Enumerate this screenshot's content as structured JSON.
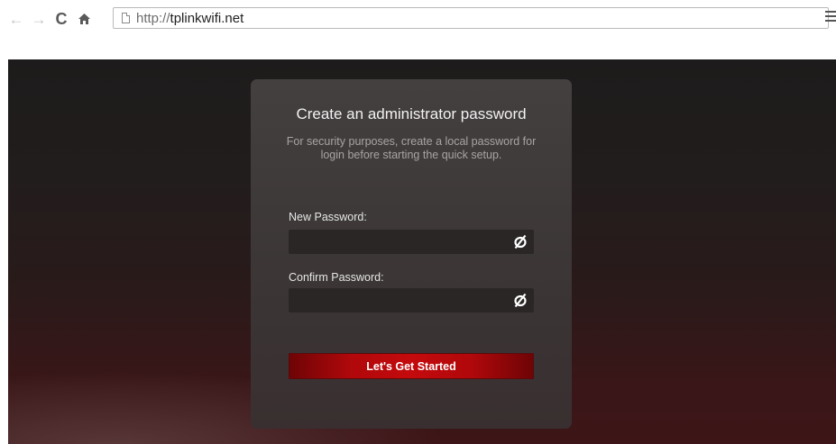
{
  "browser": {
    "nav": {
      "back_icon": "arrow-left-icon",
      "forward_icon": "arrow-right-icon",
      "reload_icon": "reload-icon",
      "home_icon": "home-icon"
    },
    "address_bar": {
      "scheme": "http://",
      "host": "tplinkwifi.net"
    },
    "menu_icon": "hamburger-menu-icon"
  },
  "setup_card": {
    "title": "Create an administrator password",
    "description": "For security purposes, create a local password for login before starting the quick setup.",
    "new_password": {
      "label": "New Password:",
      "value": "",
      "toggle_icon": "eye-slash-icon"
    },
    "confirm_password": {
      "label": "Confirm Password:",
      "value": "",
      "toggle_icon": "eye-slash-icon"
    },
    "submit_label": "Let's Get Started"
  },
  "colors": {
    "accent": "#c40a0c",
    "card_bg": "#3d3737",
    "page_bg": "#221d1d",
    "field_bg": "#2b2626"
  }
}
